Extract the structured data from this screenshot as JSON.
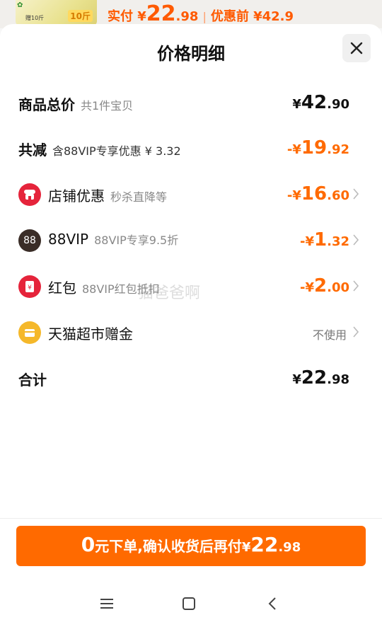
{
  "background": {
    "product_badge_text": "赠10斤",
    "product_badge_num": "10斤",
    "paid_label": "实付 ¥",
    "paid_int": "22",
    "paid_dec": ".98",
    "before_discount": "优惠前 ¥42.9"
  },
  "sheet": {
    "title": "价格明细"
  },
  "rows": {
    "total": {
      "label": "商品总价",
      "sub": "共1件宝贝",
      "cur": "¥",
      "int": "42",
      "dec": ".90"
    },
    "reduce": {
      "label": "共减",
      "sub": "含88VIP专享优惠 ¥ 3.32",
      "cur": "-¥",
      "int": "19",
      "dec": ".92"
    },
    "shop": {
      "label": "店铺优惠",
      "sub": "秒杀直降等",
      "cur": "-¥",
      "int": "16",
      "dec": ".60"
    },
    "vip": {
      "label": "88VIP",
      "sub": "88VIP专享9.5折",
      "cur": "-¥",
      "int": "1",
      "dec": ".32",
      "icon_text": "88"
    },
    "redpack": {
      "label": "红包",
      "sub": "88VIP红包抵扣",
      "cur": "-¥",
      "int": "2",
      "dec": ".00"
    },
    "bonus": {
      "label": "天猫超市赠金",
      "value": "不使用"
    },
    "sum": {
      "label": "合计",
      "cur": "¥",
      "int": "22",
      "dec": ".98"
    }
  },
  "cta": {
    "a": "0",
    "b": "元下单,",
    "c": " 确认收货后再付",
    "cur": "¥",
    "int": "22",
    "dec": ".98"
  },
  "watermark": "猫爸爸啊",
  "colors": {
    "accent": "#ff6a00",
    "shop_icon": "#e5243b",
    "vip_icon": "#3a2d27",
    "redpack_icon": "#e5243b",
    "bonus_icon": "#f5b82a"
  }
}
